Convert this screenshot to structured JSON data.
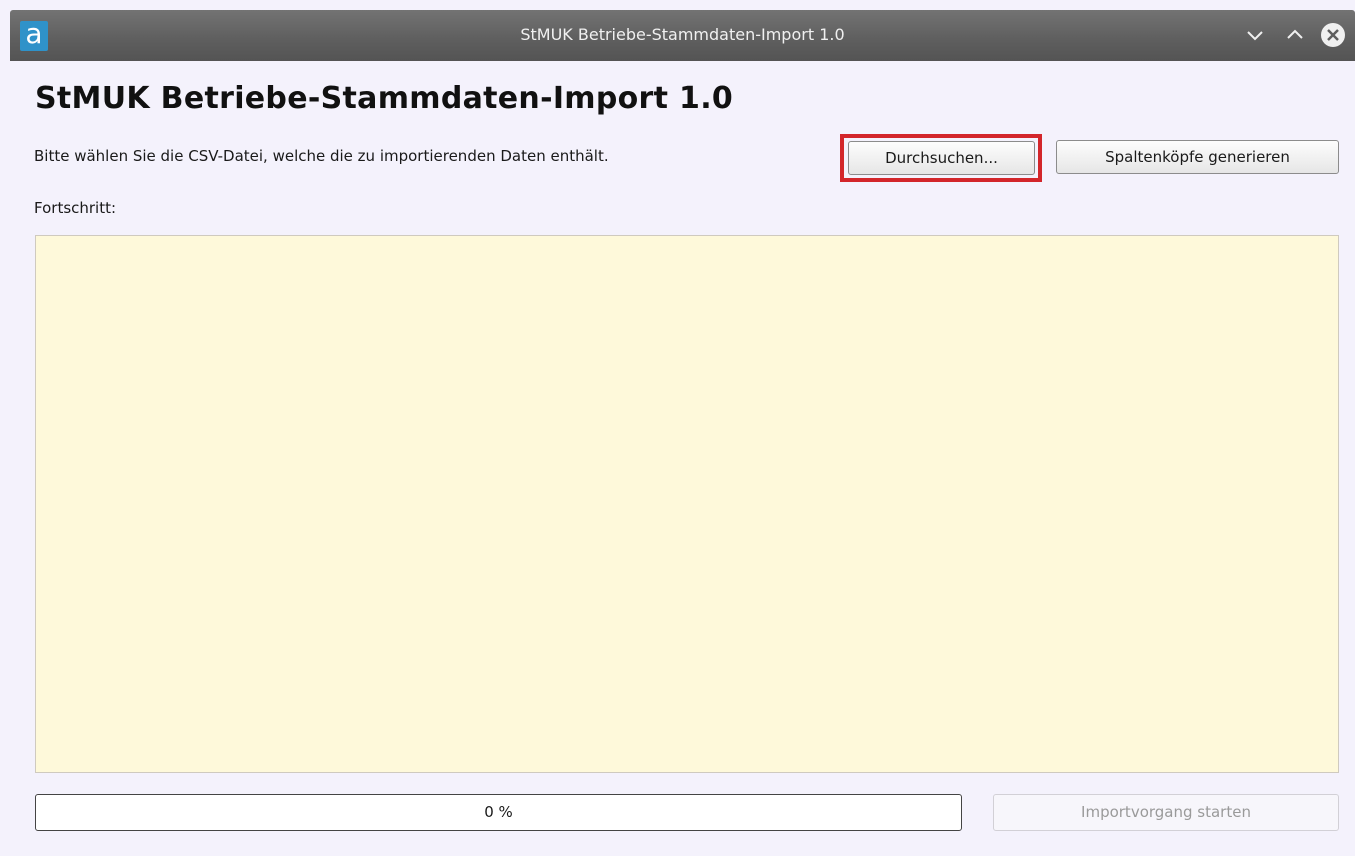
{
  "window": {
    "title": "StMUK Betriebe-Stammdaten-Import 1.0",
    "app_icon_letter": "a",
    "controls": [
      "minimize-icon",
      "maximize-icon",
      "close-icon"
    ]
  },
  "main": {
    "heading": "StMUK Betriebe-Stammdaten-Import 1.0",
    "instruction": "Bitte wählen Sie die CSV-Datei, welche die zu importierenden Daten enthält.",
    "browse_label": "Durchsuchen...",
    "headers_label": "Spaltenköpfe generieren",
    "progress_label": "Fortschritt:",
    "log_text": "",
    "progress": {
      "value": 0,
      "text": "0 %"
    },
    "start_label": "Importvorgang starten",
    "start_enabled": false
  },
  "colors": {
    "log_background": "#fef9da",
    "highlight_border": "#d3262b",
    "titlebar": "#5e5e5e",
    "app_icon": "#2f92c9"
  }
}
